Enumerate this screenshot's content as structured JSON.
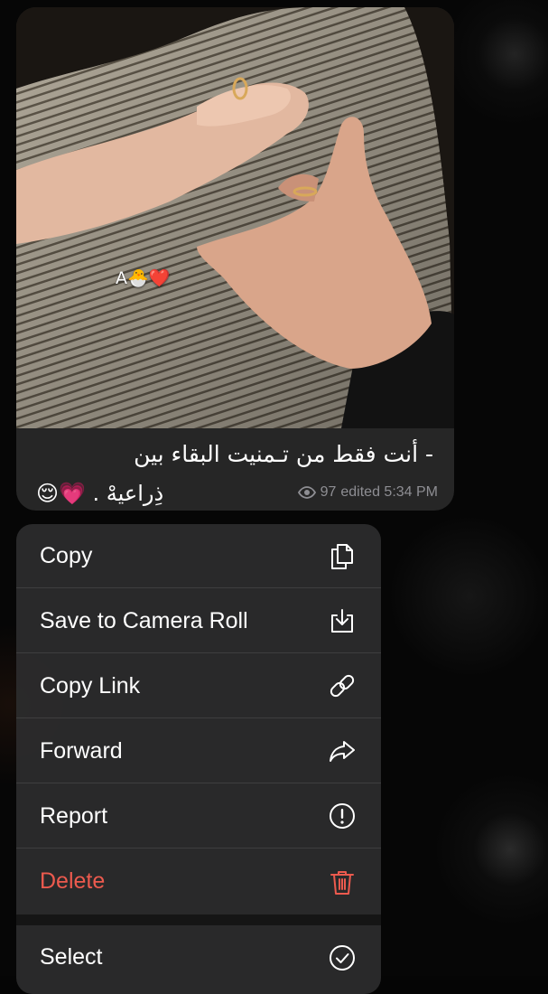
{
  "message": {
    "photo_overlay_text": "A🐣❤️",
    "caption_line1": "- أنت فقط من تـمنيت البقاء بين",
    "caption_line2": "😌💗 . ذِراعيهْ",
    "views": "97",
    "edited_time": "edited 5:34 PM"
  },
  "menu": {
    "items": [
      {
        "label": "Copy",
        "icon": "copy-icon"
      },
      {
        "label": "Save to Camera Roll",
        "icon": "save-download-icon"
      },
      {
        "label": "Copy Link",
        "icon": "link-icon"
      },
      {
        "label": "Forward",
        "icon": "forward-arrow-icon"
      },
      {
        "label": "Report",
        "icon": "exclamation-circle-icon"
      },
      {
        "label": "Delete",
        "icon": "trash-icon"
      },
      {
        "label": "Select",
        "icon": "checkmark-circle-icon"
      }
    ]
  },
  "colors": {
    "menu_background": "#2c2c2e",
    "bubble_background": "#262626",
    "delete_red": "#ec5a4e",
    "meta_gray": "#8e8e93"
  }
}
